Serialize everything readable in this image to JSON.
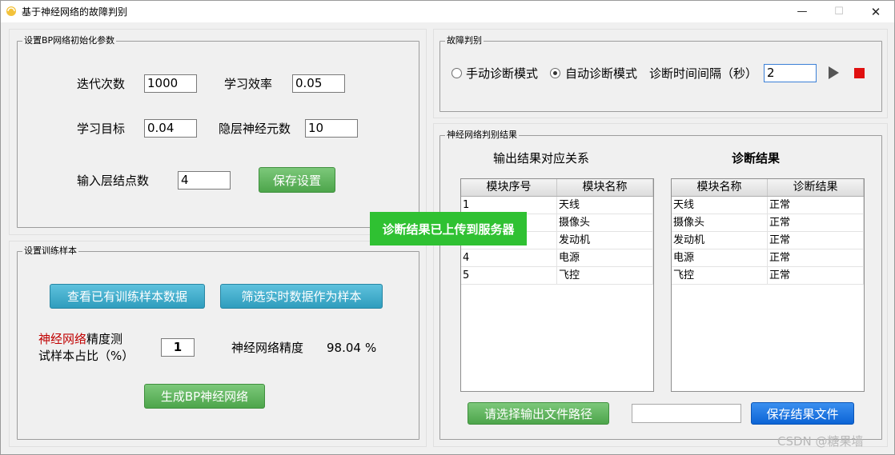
{
  "window": {
    "title": "基于神经网络的故障判别",
    "minimize_glyph": "—",
    "maximize_glyph": "☐",
    "close_glyph": "✕"
  },
  "bp_params": {
    "group_title": "设置BP网络初始化参数",
    "iterations_label": "迭代次数",
    "iterations_value": "1000",
    "learning_rate_label": "学习效率",
    "learning_rate_value": "0.05",
    "target_label": "学习目标",
    "target_value": "0.04",
    "hidden_label": "隐层神经元数",
    "hidden_value": "10",
    "input_nodes_label": "输入层结点数",
    "input_nodes_value": "4",
    "save_button": "保存设置"
  },
  "training": {
    "group_title": "设置训练样本",
    "view_button": "查看已有训练样本数据",
    "filter_button": "筛选实时数据作为样本",
    "ratio_label_red": "神经网络",
    "ratio_label_rest": "精度测",
    "ratio_label_line2": "试样本占比（%）",
    "ratio_value": "1",
    "accuracy_label": "神经网络精度",
    "accuracy_value": "98.04",
    "accuracy_unit": "%",
    "generate_button": "生成BP神经网络"
  },
  "fault": {
    "group_title": "故障判别",
    "manual_mode": "手动诊断模式",
    "auto_mode": "自动诊断模式",
    "interval_label": "诊断时间间隔（秒）",
    "interval_value": "2"
  },
  "results": {
    "group_title": "神经网络判别结果",
    "mapping_title": "输出结果对应关系",
    "diagnosis_title": "诊断结果",
    "mapping_columns": [
      "模块序号",
      "模块名称"
    ],
    "mapping_rows": [
      [
        "1",
        "天线"
      ],
      [
        "",
        "摄像头"
      ],
      [
        "",
        "发动机"
      ],
      [
        "4",
        "电源"
      ],
      [
        "5",
        "飞控"
      ]
    ],
    "diagnosis_columns": [
      "模块名称",
      "诊断结果"
    ],
    "diagnosis_rows": [
      [
        "天线",
        "正常"
      ],
      [
        "摄像头",
        "正常"
      ],
      [
        "发动机",
        "正常"
      ],
      [
        "电源",
        "正常"
      ],
      [
        "飞控",
        "正常"
      ]
    ],
    "choose_path_button": "请选择输出文件路径",
    "path_value": "",
    "save_file_button": "保存结果文件"
  },
  "toast": "诊断结果已上传到服务器",
  "watermark": "CSDN @糖果墙",
  "colors": {
    "play": "#555555",
    "stop": "#e01010",
    "toast": "#2fc132"
  }
}
